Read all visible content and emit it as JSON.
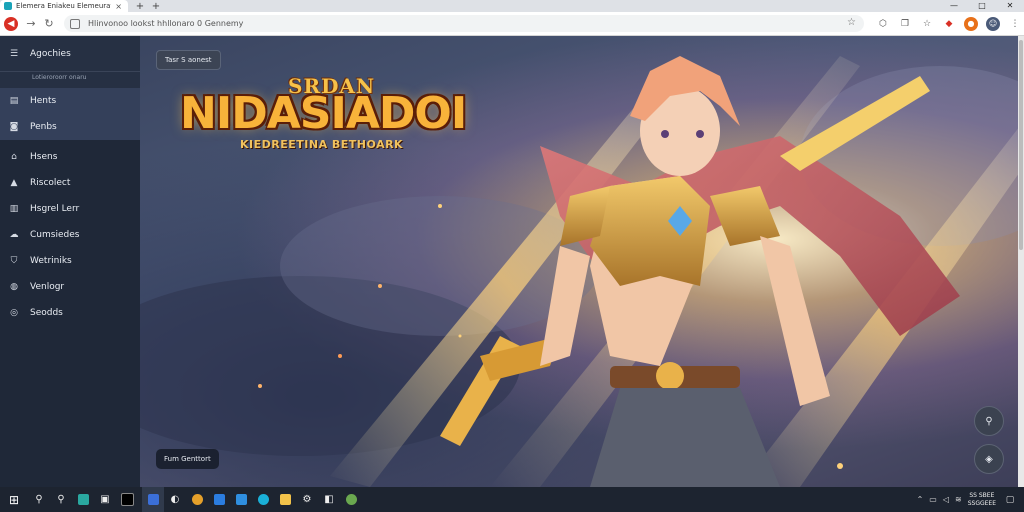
{
  "browser": {
    "tab_title": "Elemera Eniakeu  Elemeuratok",
    "tab_close": "×",
    "new_tab": "+",
    "new_tab_alt": "+",
    "window_controls": [
      "—",
      "□",
      "✕"
    ],
    "url": "Hlinvonoo lookst hhllonaro 0 Gennemy",
    "nav_icons": [
      "back-icon",
      "forward-icon",
      "reload-icon",
      "lock-icon"
    ],
    "toolbar_icons": [
      "star-icon",
      "extension-icon",
      "bookmarks-icon",
      "favorites-icon",
      "red-extension-icon",
      "orange-extension-icon",
      "profile-avatar-icon",
      "menu-icon"
    ]
  },
  "sidebar": {
    "header": {
      "icon": "menu-icon",
      "label": "Agochies"
    },
    "sub_label": "Lotieroroorr onaru",
    "items": [
      {
        "icon": "document-icon",
        "label": "Hents"
      },
      {
        "icon": "chat-icon",
        "label": "Penbs"
      },
      {
        "icon": "home-icon",
        "label": "Hsens"
      },
      {
        "icon": "warning-icon",
        "label": "Riscolect"
      },
      {
        "icon": "file-icon",
        "label": "Hsgrel Lerr"
      },
      {
        "icon": "cloud-icon",
        "label": "Cumsiedes"
      },
      {
        "icon": "shield-icon",
        "label": "Wetriniks"
      },
      {
        "icon": "globe-icon",
        "label": "Venlogr"
      },
      {
        "icon": "settings-icon",
        "label": "Seodds"
      }
    ]
  },
  "hero": {
    "chip_top": "Tasr S aonest",
    "logo_top": "SRDAN",
    "logo_main": "NIDASIADOI",
    "logo_sub": "KIEDREETINA  BETHOARK",
    "chip_bottom": "Fum Genttort",
    "buttons": [
      "user-icon",
      "map-marker-icon"
    ]
  },
  "taskbar": {
    "start_icon": "windows-icon",
    "icons": [
      "search-icon",
      "search-icon",
      "store-icon",
      "files-icon",
      "terminal-icon",
      "app-icon",
      "camera-icon",
      "chrome-icon",
      "edge-icon",
      "mail-icon",
      "browser-icon",
      "folder-icon",
      "settings-icon",
      "photos-icon",
      "game-icon"
    ],
    "tray_icons": [
      "chevron-up-icon",
      "network-icon",
      "volume-icon",
      "wifi-icon"
    ],
    "clock_time": "SS SBEE",
    "clock_date": "SSGGEEE",
    "notification_icon": "notification-icon"
  }
}
